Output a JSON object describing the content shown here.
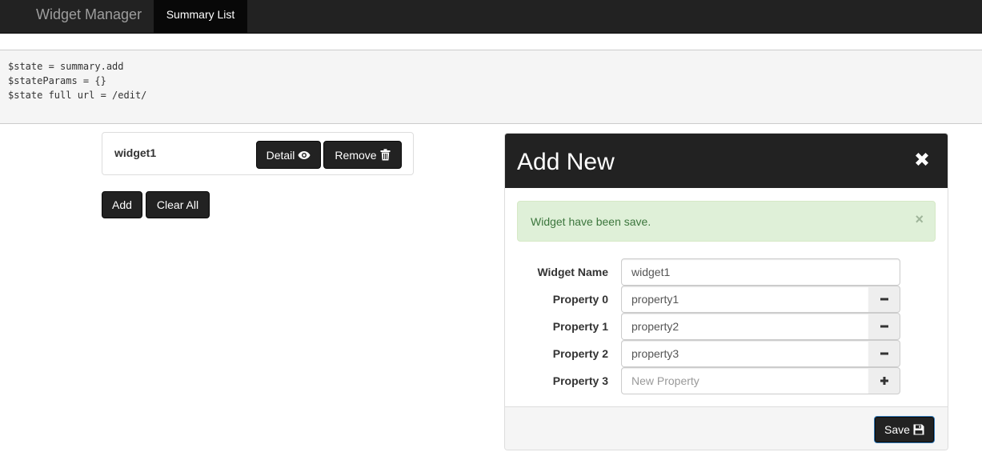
{
  "navbar": {
    "brand": "Widget Manager",
    "tabs": [
      {
        "label": "Summary List",
        "active": true
      }
    ]
  },
  "state": {
    "lines": [
      "$state = summary.add",
      "$stateParams = {}",
      "$state full url = /edit/"
    ]
  },
  "widgets": [
    {
      "name": "widget1",
      "detail_label": "Detail",
      "detail_icon": "eye-icon",
      "remove_label": "Remove",
      "remove_icon": "trash-icon"
    }
  ],
  "list_actions": {
    "add_label": "Add",
    "clear_label": "Clear All"
  },
  "add_panel": {
    "title": "Add New",
    "close_icon": "close-icon",
    "alert": {
      "text": "Widget have been save.",
      "dismiss": "×"
    },
    "widget_name": {
      "label": "Widget Name",
      "value": "widget1"
    },
    "properties": [
      {
        "label": "Property 0",
        "value": "property1",
        "action_icon": "minus-icon"
      },
      {
        "label": "Property 1",
        "value": "property2",
        "action_icon": "minus-icon"
      },
      {
        "label": "Property 2",
        "value": "property3",
        "action_icon": "minus-icon"
      }
    ],
    "new_property": {
      "label": "Property 3",
      "value": "",
      "placeholder": "New Property",
      "action_icon": "plus-icon"
    },
    "save_label": "Save",
    "save_icon": "floppy-disk-icon"
  },
  "colors": {
    "navbar_bg": "#222222",
    "active_tab_bg": "#080808",
    "alert_bg": "#dff0d8",
    "alert_text": "#3c763d",
    "button_dark": "#222222"
  }
}
